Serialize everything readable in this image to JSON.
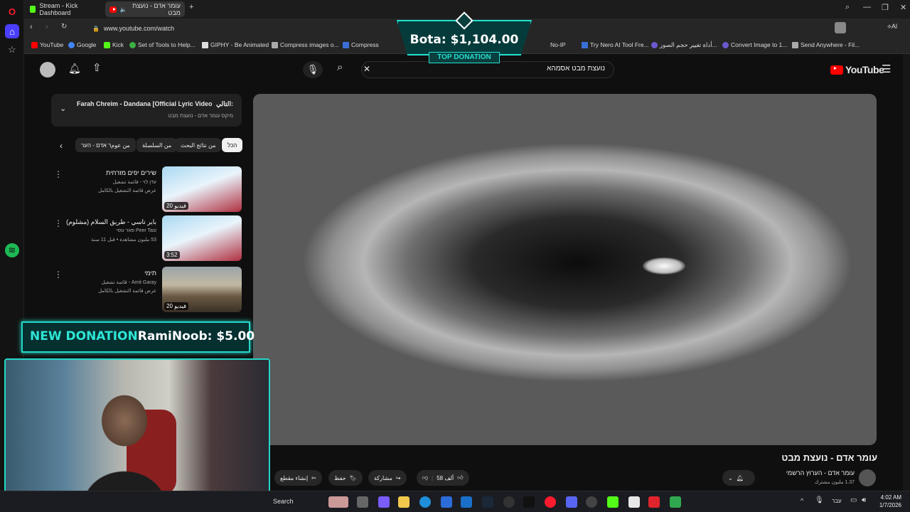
{
  "browser": {
    "tabs": [
      {
        "label": "Stream - Kick Dashboard",
        "active": false
      },
      {
        "label": "עומר אדם - נועצת מבט",
        "active": true
      }
    ],
    "url": "www.youtube.com/watch",
    "bookmarks": [
      "YouTube",
      "Google",
      "Kick",
      "Set of Tools to Help...",
      "GIPHY - Be Animated",
      "Compress images o...",
      "Compress",
      "No-IP",
      "Try Nero AI Tool Fre...",
      "أداة تغيير حجم الصور...",
      "Convert Image to 1...",
      "Send Anywhere - Fil..."
    ]
  },
  "youtube": {
    "logo": "YouTube",
    "search_value": "נועצת מבט אסמהא",
    "playlist": {
      "title": "Farah Chreim - Dandana [Official Lyric Video] (...",
      "prefix": "التالي:",
      "subtitle": "מיקס עומר אדם - נועצת מבט"
    },
    "chips": [
      "הכל",
      "من نتائج البحث",
      "من السلسلة",
      "من عومר אדם - הער"
    ],
    "recommendations": [
      {
        "title": "שירים יפים מזרחית",
        "line1": "עדן לוי - قائمة تشغيل",
        "line2": "عرض قائمة التشغيل بالكامل",
        "duration": "20 فيديو"
      },
      {
        "title": "باير تاسي - طريق السلام (مشلوم)",
        "line1": "Peer Tasi פאר טסי",
        "line2": "53 مليون مشاهدة • قبل 11 سنة",
        "duration": "3:52"
      },
      {
        "title": "תימי",
        "line1": "Amit Garay - قائمة تشغيل",
        "line2": "عرض قائمة التشغيل بالكامل",
        "duration": "20 فيديو"
      }
    ],
    "video": {
      "title": "עומר אדם - נועצת מבט",
      "channel": "עומר אדם - הערוץ הרשמי",
      "subscribers": "1.37 مليون مشترك",
      "likes": "58 ألف",
      "share_label": "مشاركة",
      "save_label": "حفظ",
      "clip_label": "إنشاء مقطع"
    }
  },
  "overlays": {
    "top_donation": {
      "amount": "Bota: $1,104.00",
      "label": "TOP DONATION"
    },
    "new_donation": {
      "label": "NEW DONATION",
      "value": "RamiNoob: $5.00"
    }
  },
  "taskbar": {
    "search_placeholder": "Search",
    "language": "עבר",
    "time": "4:02 AM",
    "date": "1/7/2026"
  },
  "colors": {
    "accent": "#24d6c7",
    "youtube_red": "#ff0000",
    "kick_green": "#53fc18"
  }
}
